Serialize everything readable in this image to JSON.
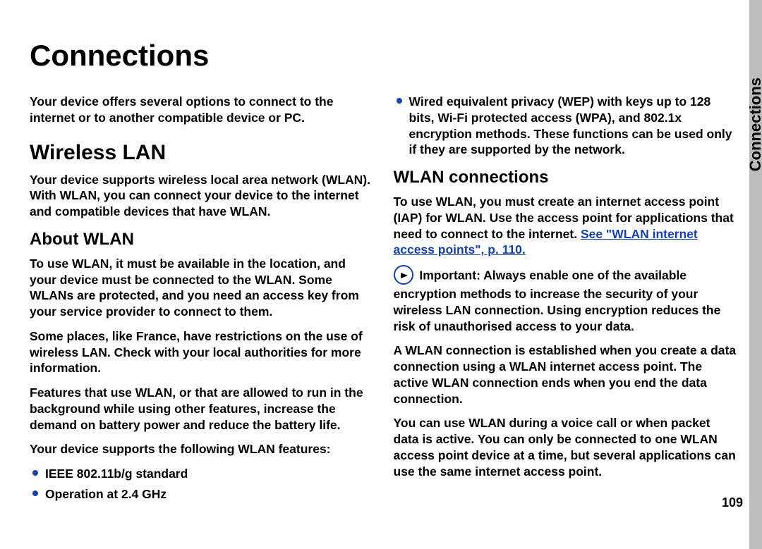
{
  "thumb": {
    "label": "Connections"
  },
  "pageNumber": "109",
  "title": "Connections",
  "intro": "Your device offers several options to connect to the internet or to another compatible device or PC.",
  "wlan": {
    "heading": "Wireless LAN",
    "intro": "Your device supports wireless local area network (WLAN). With WLAN, you can connect your device to the internet and compatible devices that have WLAN.",
    "about": {
      "heading": "About WLAN",
      "p1": "To use WLAN, it must be available in the location, and your device must be connected to the WLAN. Some WLANs are protected, and you need an access key from your service provider to connect to them.",
      "p2": "Some places, like France, have restrictions on the use of wireless LAN. Check with your local authorities for more information.",
      "p3": "Features that use WLAN, or that are allowed to run in the background while using other features, increase the demand on battery power and reduce the battery life.",
      "p4": "Your device supports the following WLAN features:",
      "features": [
        "IEEE 802.11b/g standard",
        "Operation at 2.4 GHz",
        "Wired equivalent privacy (WEP) with keys up to 128 bits, Wi-Fi protected access (WPA), and 802.1x encryption methods. These functions can be used only if they are supported by the network."
      ]
    },
    "connections": {
      "heading": "WLAN connections",
      "p1a": "To use WLAN, you must create an internet access point (IAP) for WLAN. Use the access point for applications that need to connect to the internet. ",
      "link": "See \"WLAN internet access points\", p. 110.",
      "importantLabel": "Important:",
      "importantText": " Always enable one of the available encryption methods to increase the security of your wireless LAN connection. Using encryption reduces the risk of unauthorised access to your data.",
      "p3": "A WLAN connection is established when you create a data connection using a WLAN internet access point. The active WLAN connection ends when you end the data connection.",
      "p4": "You can use WLAN during a voice call or when packet data is active. You can only be connected to one WLAN access point device at a time, but several applications can use the same internet access point."
    }
  }
}
